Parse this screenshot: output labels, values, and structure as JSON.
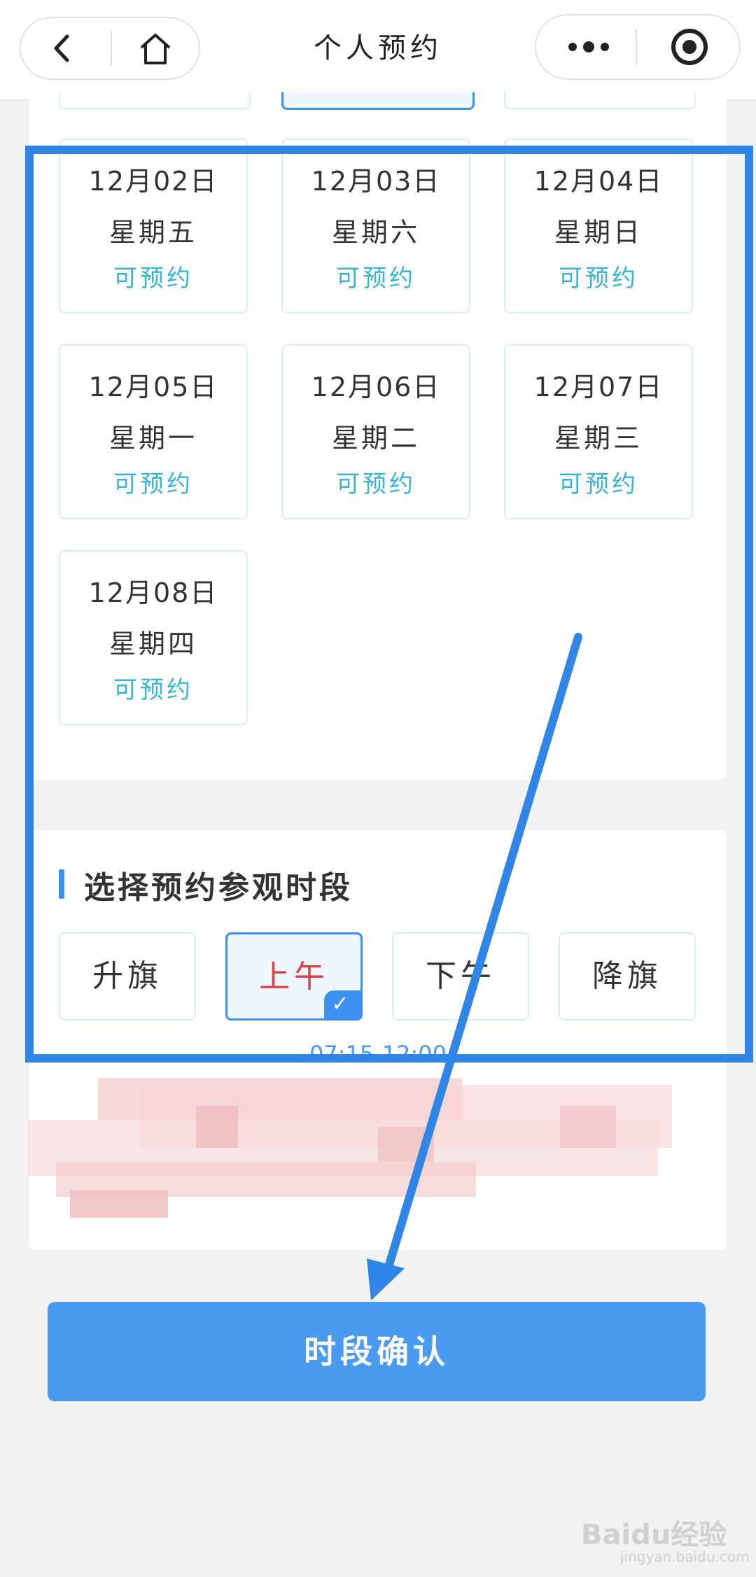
{
  "navbar": {
    "title": "个人预约",
    "back_icon": "chevron-left-icon",
    "home_icon": "home-icon",
    "more_icon": "more-dots-icon",
    "record_icon": "target-icon"
  },
  "dates": [
    {
      "date": "12月02日",
      "weekday": "星期五",
      "status": "可预约"
    },
    {
      "date": "12月03日",
      "weekday": "星期六",
      "status": "可预约"
    },
    {
      "date": "12月04日",
      "weekday": "星期日",
      "status": "可预约"
    },
    {
      "date": "12月05日",
      "weekday": "星期一",
      "status": "可预约"
    },
    {
      "date": "12月06日",
      "weekday": "星期二",
      "status": "可预约"
    },
    {
      "date": "12月07日",
      "weekday": "星期三",
      "status": "可预约"
    },
    {
      "date": "12月08日",
      "weekday": "星期四",
      "status": "可预约"
    }
  ],
  "period_section": {
    "title": "选择预约参观时段",
    "slots": [
      {
        "label": "升旗",
        "selected": false
      },
      {
        "label": "上午",
        "selected": true
      },
      {
        "label": "下午",
        "selected": false
      },
      {
        "label": "降旗",
        "selected": false
      }
    ],
    "partial_time": "07:15-12:00"
  },
  "confirm_button": "时段确认",
  "watermark": {
    "brand": "Baidu经验",
    "url": "jingyan.baidu.com"
  },
  "colors": {
    "accent": "#3d8ff0",
    "available": "#36b4d8",
    "selected_text": "#d94040",
    "annotation": "#2f86e6"
  }
}
